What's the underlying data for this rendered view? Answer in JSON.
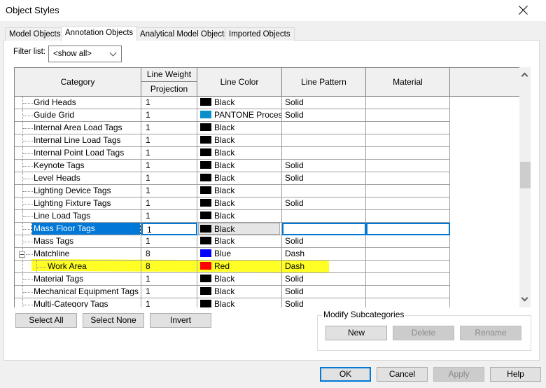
{
  "window": {
    "title": "Object Styles",
    "close_label": "close"
  },
  "tabs": [
    {
      "label": "Model Objects",
      "active": false
    },
    {
      "label": "Annotation Objects",
      "active": true
    },
    {
      "label": "Analytical Model Objects",
      "active": false
    },
    {
      "label": "Imported Objects",
      "active": false
    }
  ],
  "filter": {
    "label": "Filter list:",
    "value": "<show all>"
  },
  "grid": {
    "headers": {
      "category": "Category",
      "line_weight": "Line Weight",
      "projection": "Projection",
      "line_color": "Line Color",
      "line_pattern": "Line Pattern",
      "material": "Material"
    },
    "rows": [
      {
        "category": "Grid Heads",
        "weight": "1",
        "color_name": "Black",
        "color": "#000000",
        "pattern": "Solid",
        "material": ""
      },
      {
        "category": "Guide Grid",
        "weight": "1",
        "color_name": "PANTONE Process",
        "color": "#0a8fc8",
        "pattern": "Solid",
        "material": ""
      },
      {
        "category": "Internal Area Load Tags",
        "weight": "1",
        "color_name": "Black",
        "color": "#000000",
        "pattern": "",
        "material": ""
      },
      {
        "category": "Internal Line Load Tags",
        "weight": "1",
        "color_name": "Black",
        "color": "#000000",
        "pattern": "",
        "material": ""
      },
      {
        "category": "Internal Point Load Tags",
        "weight": "1",
        "color_name": "Black",
        "color": "#000000",
        "pattern": "",
        "material": ""
      },
      {
        "category": "Keynote Tags",
        "weight": "1",
        "color_name": "Black",
        "color": "#000000",
        "pattern": "Solid",
        "material": ""
      },
      {
        "category": "Level Heads",
        "weight": "1",
        "color_name": "Black",
        "color": "#000000",
        "pattern": "Solid",
        "material": ""
      },
      {
        "category": "Lighting Device Tags",
        "weight": "1",
        "color_name": "Black",
        "color": "#000000",
        "pattern": "",
        "material": ""
      },
      {
        "category": "Lighting Fixture Tags",
        "weight": "1",
        "color_name": "Black",
        "color": "#000000",
        "pattern": "Solid",
        "material": ""
      },
      {
        "category": "Line Load Tags",
        "weight": "1",
        "color_name": "Black",
        "color": "#000000",
        "pattern": "",
        "material": ""
      },
      {
        "category": "Mass Floor Tags",
        "weight": "1",
        "color_name": "Black",
        "color": "#000000",
        "pattern": "",
        "material": "",
        "selected": true
      },
      {
        "category": "Mass Tags",
        "weight": "1",
        "color_name": "Black",
        "color": "#000000",
        "pattern": "Solid",
        "material": ""
      },
      {
        "category": "Matchline",
        "weight": "8",
        "color_name": "Blue",
        "color": "#0000ff",
        "pattern": "Dash",
        "material": "",
        "expanded": true
      },
      {
        "category": "Work Area",
        "weight": "8",
        "color_name": "Red",
        "color": "#ff0000",
        "pattern": "Dash",
        "material": "",
        "child": true,
        "highlighted": true
      },
      {
        "category": "Material Tags",
        "weight": "1",
        "color_name": "Black",
        "color": "#000000",
        "pattern": "Solid",
        "material": ""
      },
      {
        "category": "Mechanical Equipment Tags",
        "weight": "1",
        "color_name": "Black",
        "color": "#000000",
        "pattern": "Solid",
        "material": ""
      },
      {
        "category": "Multi-Category Tags",
        "weight": "1",
        "color_name": "Black",
        "color": "#000000",
        "pattern": "Solid",
        "material": ""
      }
    ]
  },
  "selection_buttons": {
    "select_all": "Select All",
    "select_none": "Select None",
    "invert": "Invert"
  },
  "modify_subcategories": {
    "label": "Modify Subcategories",
    "new": "New",
    "delete": "Delete",
    "rename": "Rename"
  },
  "footer": {
    "ok": "OK",
    "cancel": "Cancel",
    "apply": "Apply",
    "help": "Help"
  },
  "colors": {
    "accent": "#0078d7",
    "highlight": "#ffff00"
  }
}
